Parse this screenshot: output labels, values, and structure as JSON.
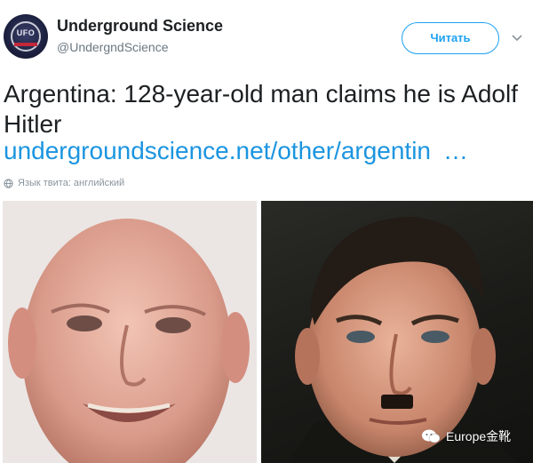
{
  "account": {
    "avatar_text": "UFO",
    "name": "Underground Science",
    "handle": "@UndergndScience"
  },
  "follow_button": "Читать",
  "tweet": {
    "text": "Argentina: 128-year-old man claims he is Adolf Hitler",
    "link": "undergroundscience.net/other/argentin",
    "link_ellipsis": "…",
    "language_note": "Язык твита: английский"
  },
  "watermark": "Europe金靴",
  "colors": {
    "accent": "#1da1f2",
    "link": "#1b95e0",
    "text": "#1c2022",
    "muted": "#6b7882"
  }
}
